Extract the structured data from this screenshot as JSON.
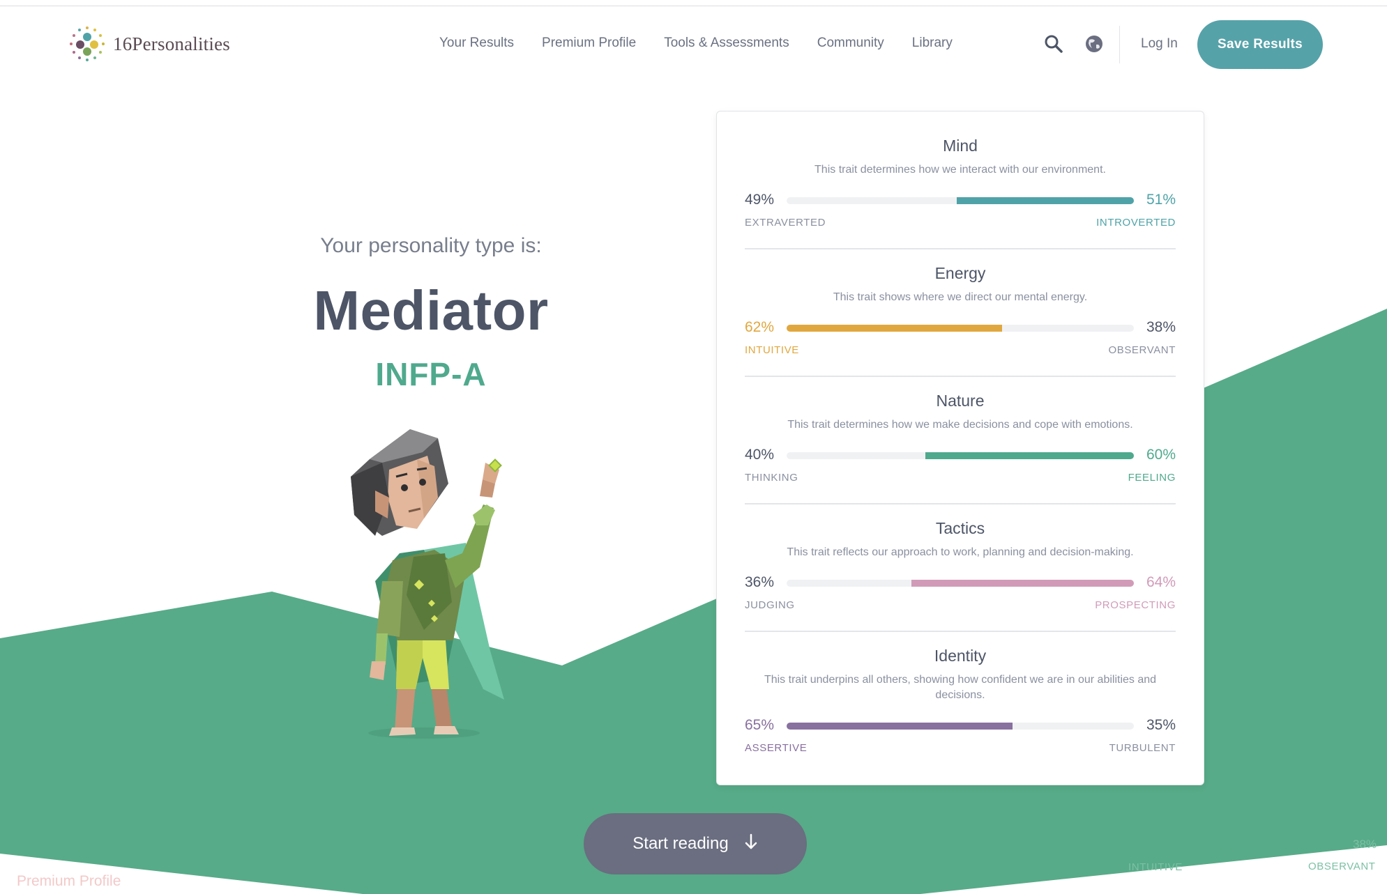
{
  "brand": {
    "name": "16Personalities"
  },
  "nav": {
    "items": [
      {
        "label": "Your Results"
      },
      {
        "label": "Premium Profile"
      },
      {
        "label": "Tools & Assessments"
      },
      {
        "label": "Community"
      },
      {
        "label": "Library"
      }
    ],
    "login_label": "Log In",
    "save_label": "Save Results",
    "icons": [
      "search-icon",
      "globe-icon"
    ]
  },
  "hero": {
    "pre": "Your personality type is:",
    "title": "Mediator",
    "code": "INFP-A"
  },
  "traits": [
    {
      "name": "Mind",
      "description": "This trait determines how we interact with our environment.",
      "left_pct": "49%",
      "right_pct": "51%",
      "left_label": "EXTRAVERTED",
      "right_label": "INTROVERTED",
      "dominant": "right",
      "value": 51,
      "color": "#4fa3a8"
    },
    {
      "name": "Energy",
      "description": "This trait shows where we direct our mental energy.",
      "left_pct": "62%",
      "right_pct": "38%",
      "left_label": "INTUITIVE",
      "right_label": "OBSERVANT",
      "dominant": "left",
      "value": 62,
      "color": "#e1a73f"
    },
    {
      "name": "Nature",
      "description": "This trait determines how we make decisions and cope with emotions.",
      "left_pct": "40%",
      "right_pct": "60%",
      "left_label": "THINKING",
      "right_label": "FEELING",
      "dominant": "right",
      "value": 60,
      "color": "#4fa98d"
    },
    {
      "name": "Tactics",
      "description": "This trait reflects our approach to work, planning and decision-making.",
      "left_pct": "36%",
      "right_pct": "64%",
      "left_label": "JUDGING",
      "right_label": "PROSPECTING",
      "dominant": "right",
      "value": 64,
      "color": "#d19bb8"
    },
    {
      "name": "Identity",
      "description": "This trait underpins all others, showing how confident we are in our abilities and decisions.",
      "left_pct": "65%",
      "right_pct": "35%",
      "left_label": "ASSERTIVE",
      "right_label": "TURBULENT",
      "dominant": "left",
      "value": 65,
      "color": "#88709f"
    }
  ],
  "cta": {
    "label": "Start reading"
  },
  "ghost": {
    "premium": "Premium Profile",
    "pct": "38%",
    "observant": "OBSERVANT",
    "intuitive": "INTUITIVE"
  },
  "colors": {
    "accent": "#56a2a9",
    "green": "#57ab88",
    "text_dark": "#4d5567",
    "button_dark": "#6a6e80"
  }
}
